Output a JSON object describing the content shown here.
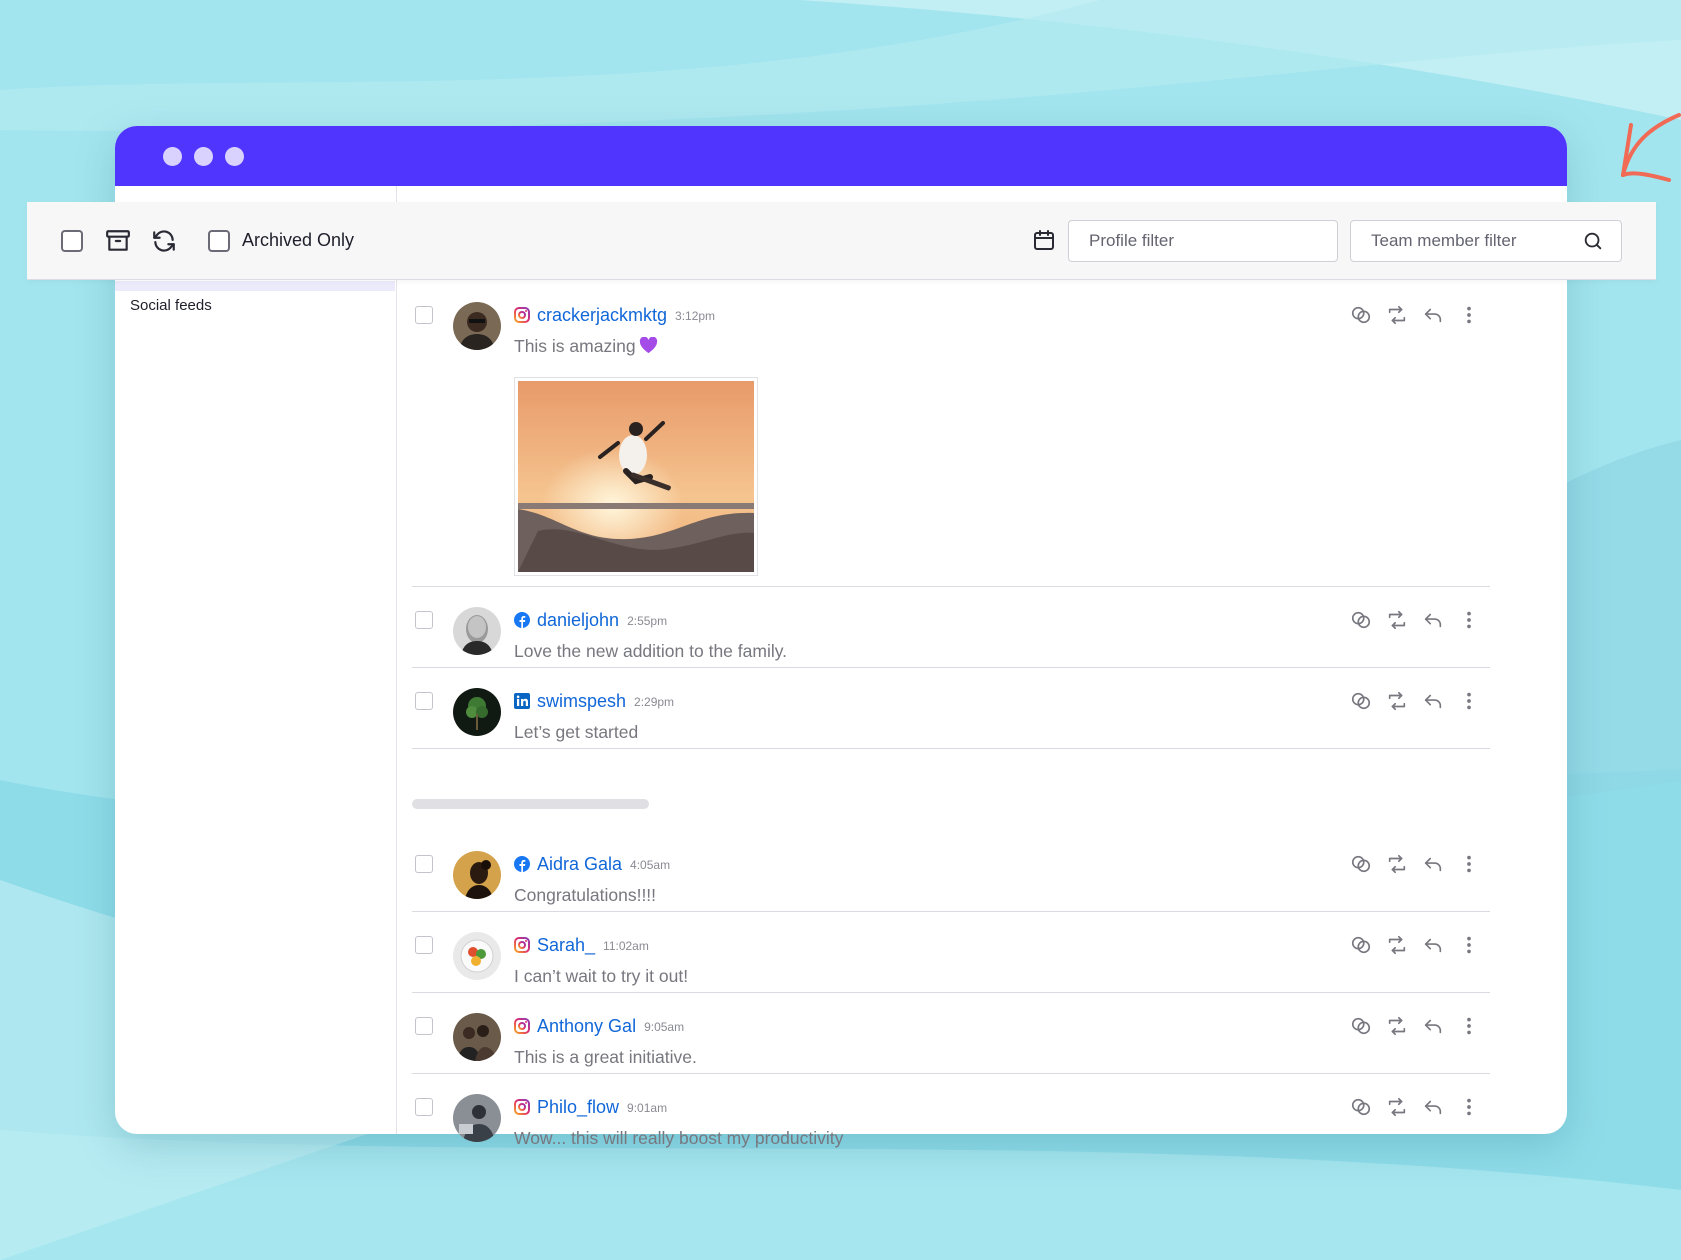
{
  "window": {
    "dots": [
      "dot-1",
      "dot-2",
      "dot-3"
    ]
  },
  "sidebar": {
    "items": [
      {
        "label": "Social feeds"
      }
    ]
  },
  "toolbar": {
    "archived_only_label": "Archived Only",
    "profile_filter_placeholder": "Profile filter",
    "team_member_filter_placeholder": "Team member filter"
  },
  "colors": {
    "accent": "#5035ff",
    "link": "#1167d8",
    "background": "#a6e6ef",
    "arrow": "#f06a55"
  },
  "posts_group_1": [
    {
      "network": "instagram",
      "username": "crackerjackmktg",
      "time": "3:12pm",
      "text": "This is amazing",
      "emoji": "purple-heart",
      "has_image": true
    },
    {
      "network": "facebook",
      "username": "danieljohn",
      "time": "2:55pm",
      "text": "Love the new addition to the family."
    },
    {
      "network": "linkedin",
      "username": "swimspesh",
      "time": "2:29pm",
      "text": "Let’s get started"
    }
  ],
  "posts_group_2": [
    {
      "network": "facebook",
      "username": "Aidra Gala",
      "time": "4:05am",
      "text": "Congratulations!!!!"
    },
    {
      "network": "instagram",
      "username": "Sarah_",
      "time": "11:02am",
      "text": "I can’t wait to try it out!"
    },
    {
      "network": "instagram",
      "username": "Anthony Gal",
      "time": "9:05am",
      "text": "This is a great initiative."
    },
    {
      "network": "instagram",
      "username": "Philo_flow",
      "time": "9:01am",
      "text": "Wow... this will really boost my productivity"
    }
  ],
  "icons": {
    "toolbar": [
      "select-all-checkbox",
      "archive-icon",
      "refresh-icon",
      "calendar-icon",
      "search-icon"
    ],
    "post_actions": [
      "assign-icon",
      "retweet-icon",
      "reply-icon",
      "more-icon"
    ]
  }
}
